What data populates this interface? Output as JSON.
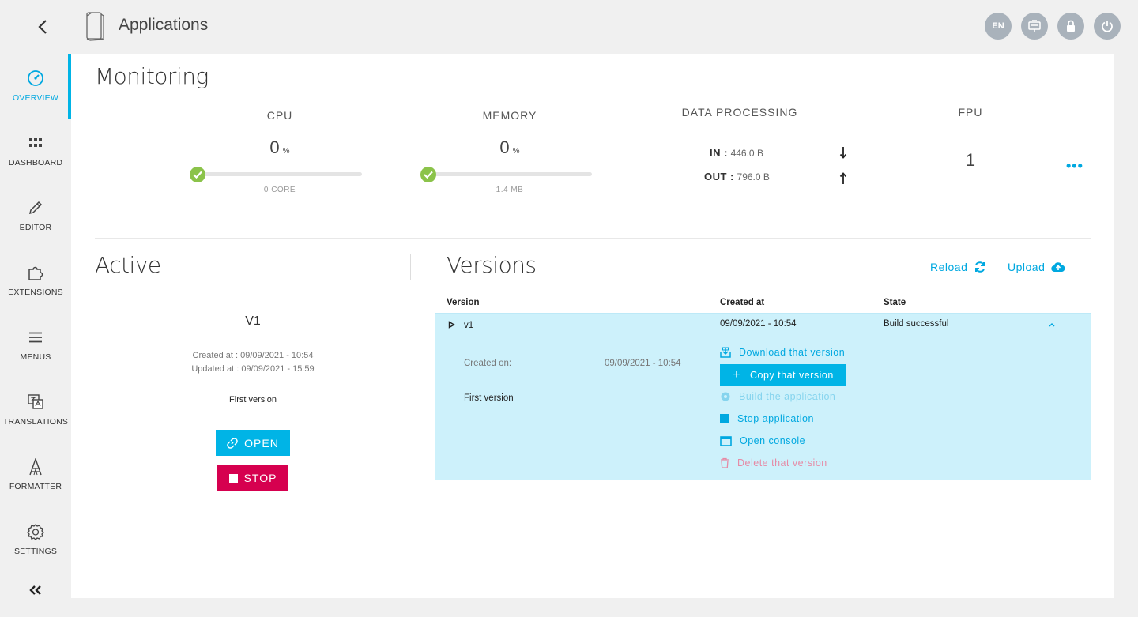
{
  "header": {
    "title": "Applications",
    "actions": [
      {
        "name": "language",
        "label": "EN"
      },
      {
        "name": "presentation",
        "label": ""
      },
      {
        "name": "lock",
        "label": ""
      },
      {
        "name": "power",
        "label": ""
      }
    ]
  },
  "sidebar": {
    "items": [
      {
        "label": "OVERVIEW",
        "icon": "gauge-icon",
        "active": true
      },
      {
        "label": "DASHBOARD",
        "icon": "grid-icon"
      },
      {
        "label": "EDITOR",
        "icon": "pencil-icon"
      },
      {
        "label": "EXTENSIONS",
        "icon": "puzzle-icon"
      },
      {
        "label": "MENUS",
        "icon": "hamburger-icon"
      },
      {
        "label": "TRANSLATIONS",
        "icon": "translate-icon"
      },
      {
        "label": "FORMATTER",
        "icon": "formatter-icon"
      },
      {
        "label": "SETTINGS",
        "icon": "gear-icon"
      }
    ]
  },
  "monitoring": {
    "title": "Monitoring",
    "cpu": {
      "label": "CPU",
      "value": "0",
      "unit": "%",
      "sub": "0 CORE",
      "level": 0
    },
    "memory": {
      "label": "MEMORY",
      "value": "0",
      "unit": "%",
      "sub": "1.4 MB",
      "level": 0
    },
    "data_processing": {
      "label": "DATA PROCESSING",
      "in_label": "IN :",
      "in_value": "446.0 B",
      "out_label": "OUT :",
      "out_value": "796.0 B"
    },
    "fpu": {
      "label": "FPU",
      "value": "1"
    },
    "more": "•••"
  },
  "active": {
    "title": "Active",
    "version": "V1",
    "created": "Created at : 09/09/2021 - 10:54",
    "updated": "Updated at : 09/09/2021 - 15:59",
    "description": "First version",
    "open_label": "OPEN",
    "stop_label": "STOP"
  },
  "versions": {
    "title": "Versions",
    "reload_label": "Reload",
    "upload_label": "Upload",
    "columns": [
      "Version",
      "Created at",
      "State"
    ],
    "rows": [
      {
        "version": "v1",
        "created_at": "09/09/2021 - 10:54",
        "state": "Build successful",
        "created_on_label": "Created on:",
        "created_on_value": "09/09/2021 - 10:54",
        "description": "First version",
        "actions": {
          "download": "Download that version",
          "copy": "Copy that version",
          "build": "Build the application",
          "stop": "Stop application",
          "console": "Open console",
          "delete": "Delete that version"
        }
      }
    ]
  },
  "colors": {
    "accent": "#00b4e6",
    "danger": "#d6004f",
    "success": "#8bc34a",
    "expanded_row": "#cdf1fb"
  }
}
